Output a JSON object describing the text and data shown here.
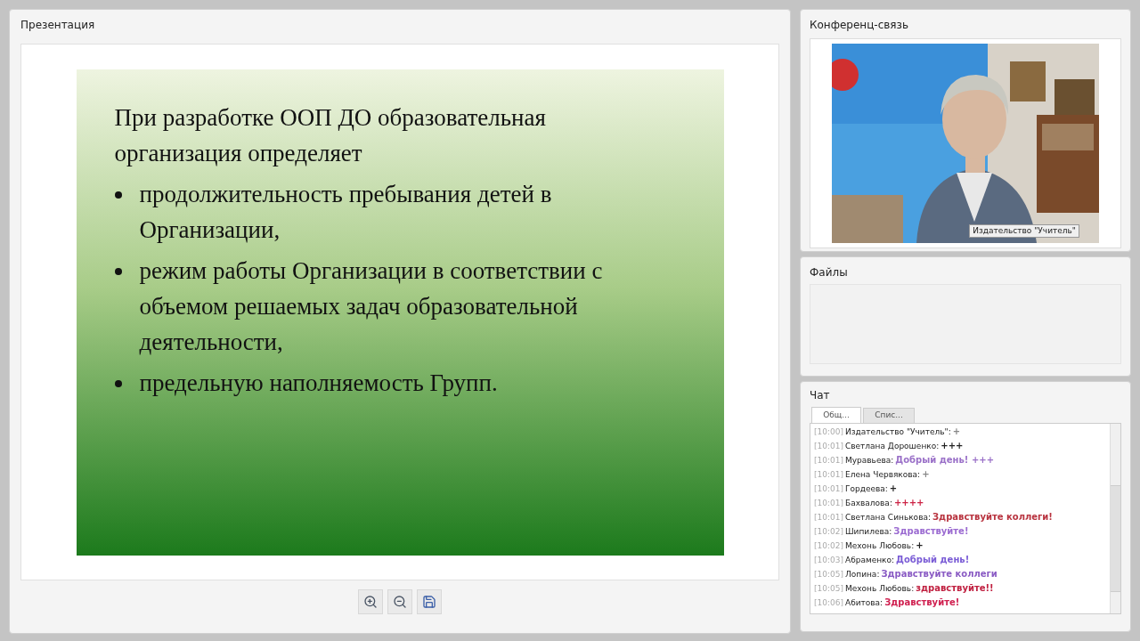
{
  "presentation": {
    "title": "Презентация",
    "slide": {
      "heading": "При разработке ООП ДО образовательная организация определяет",
      "bullets": [
        "продолжительность пребывания детей в Организации,",
        "режим работы Организации в соответствии с объемом решаемых задач образовательной деятельности,",
        "предельную наполняемость Групп."
      ]
    },
    "toolbar": [
      {
        "kind": "zoom-in"
      },
      {
        "kind": "zoom-out"
      },
      {
        "kind": "save"
      }
    ]
  },
  "conference": {
    "title": "Конференц-связь",
    "video": {
      "kind": "picture",
      "caption": "Издательство \"Учитель\""
    }
  },
  "files": {
    "title": "Файлы"
  },
  "chat": {
    "title": "Чат",
    "tabs": [
      {
        "label": "Общ...",
        "selected": true
      },
      {
        "label": "Спис...",
        "selected": false
      }
    ],
    "messages": [
      {
        "time": "[10:00]",
        "name": "Издательство \"Учитель\":",
        "text": "+",
        "color": "#888888"
      },
      {
        "time": "[10:01]",
        "name": "Светлана Дорошенко:",
        "text": "+++",
        "color": "#222222"
      },
      {
        "time": "[10:01]",
        "name": "Муравьева:",
        "text": "Добрый день! +++",
        "color": "#9a70c8"
      },
      {
        "time": "[10:01]",
        "name": "Елена Червякова:",
        "text": "+",
        "color": "#888888"
      },
      {
        "time": "[10:01]",
        "name": "Гордеева:",
        "text": "+",
        "color": "#222222"
      },
      {
        "time": "[10:01]",
        "name": "Бахвалова:",
        "text": "++++",
        "color": "#cc2244"
      },
      {
        "time": "[10:01]",
        "name": "Светлана Синькова:",
        "text": "Здравствуйте коллеги!",
        "color": "#b8333f"
      },
      {
        "time": "[10:02]",
        "name": "Шипилева:",
        "text": "Здравствуйте!",
        "color": "#9b6bd1"
      },
      {
        "time": "[10:02]",
        "name": "Мехонь Любовь:",
        "text": "+",
        "color": "#222222"
      },
      {
        "time": "[10:03]",
        "name": "Абраменко:",
        "text": "Добрый день!",
        "color": "#7a5cd6"
      },
      {
        "time": "[10:05]",
        "name": "Лопина:",
        "text": "Здравствуйте коллеги",
        "color": "#8a5bc4"
      },
      {
        "time": "[10:05]",
        "name": "Мехонь Любовь:",
        "text": "здравствуйте!!",
        "color": "#c02040"
      },
      {
        "time": "[10:06]",
        "name": "Абитова:",
        "text": "Здравствуйте!",
        "color": "#d02050"
      }
    ]
  }
}
